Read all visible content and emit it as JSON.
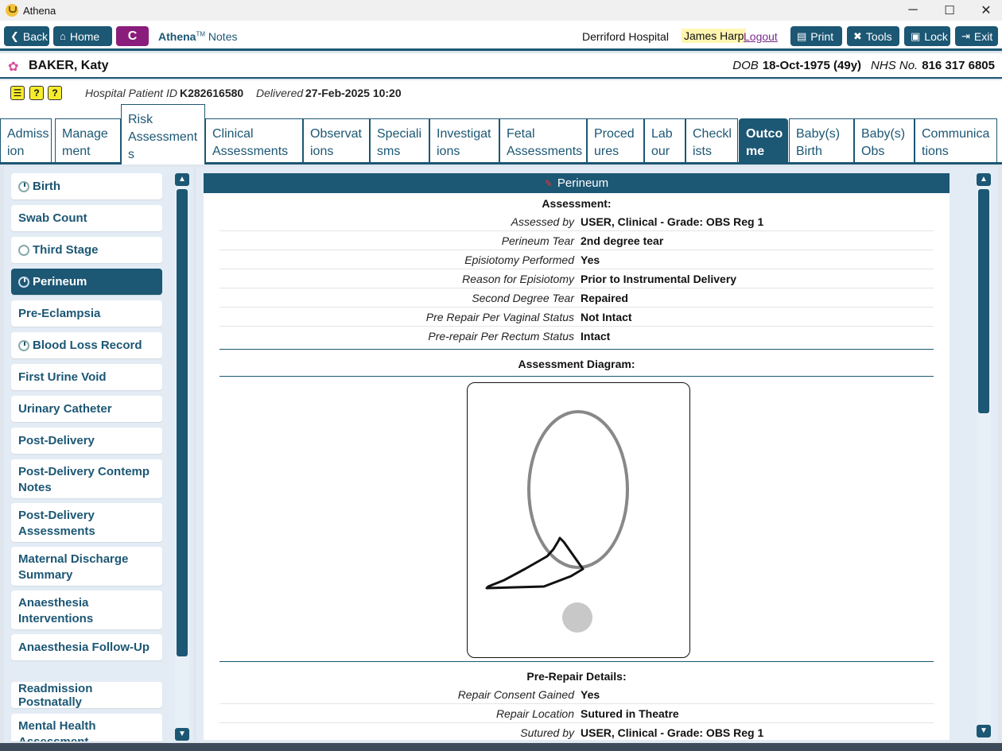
{
  "window": {
    "title": "Athena",
    "minimize": "─",
    "maximize": "☐",
    "close": "✕"
  },
  "toolbar": {
    "back": "Back",
    "home": "Home",
    "c_button": "C",
    "brand_name": "Athena",
    "brand_tm": "TM",
    "brand_suffix": "Notes",
    "hospital": "Derriford Hospital",
    "user": "James Harp",
    "logout": "Logout",
    "print": "Print",
    "tools": "Tools",
    "lock": "Lock",
    "exit": "Exit"
  },
  "patient": {
    "name": "BAKER, Katy",
    "dob_label": "DOB",
    "dob": "18-Oct-1975 (49y)",
    "nhs_label": "NHS No.",
    "nhs": "816 317 6805",
    "hospital_id_label": "Hospital Patient ID",
    "hospital_id": "K282616580",
    "delivered_label": "Delivered",
    "delivered": "27-Feb-2025 10:20"
  },
  "tabs": [
    {
      "l1": "Admiss",
      "l2": "ion"
    },
    {
      "l1": "Manage",
      "l2": "ment"
    },
    {
      "l1": "Risk",
      "l2": "Assessment",
      "l3": "s"
    },
    {
      "l1": "Clinical",
      "l2": "Assessments"
    },
    {
      "l1": "Observat",
      "l2": "ions"
    },
    {
      "l1": "Speciali",
      "l2": "sms"
    },
    {
      "l1": "Investigat",
      "l2": "ions"
    },
    {
      "l1": "Fetal",
      "l2": "Assessments"
    },
    {
      "l1": "Proced",
      "l2": "ures"
    },
    {
      "l1": "Lab",
      "l2": "our"
    },
    {
      "l1": "Checkl",
      "l2": "ists"
    },
    {
      "l1": "Outco",
      "l2": "me"
    },
    {
      "l1": "Baby(s)",
      "l2": "Birth"
    },
    {
      "l1": "Baby(s)",
      "l2": "Obs"
    },
    {
      "l1": "Communica",
      "l2": "tions"
    }
  ],
  "nav": [
    {
      "l1": "Birth",
      "status": "partial"
    },
    {
      "l1": "Swab Count"
    },
    {
      "l1": "Third Stage",
      "status": "empty"
    },
    {
      "l1": "Perineum",
      "status": "partial"
    },
    {
      "l1": "Pre-Eclampsia"
    },
    {
      "l1": "Blood Loss Record",
      "status": "partial"
    },
    {
      "l1": "First Urine Void"
    },
    {
      "l1": "Urinary Catheter"
    },
    {
      "l1": "Post-Delivery"
    },
    {
      "l1": "Post-Delivery Contemp",
      "l2": "Notes"
    },
    {
      "l1": "Post-Delivery",
      "l2": "Assessments"
    },
    {
      "l1": "Maternal Discharge",
      "l2": "Summary"
    },
    {
      "l1": "Anaesthesia",
      "l2": "Interventions"
    },
    {
      "l1": "Anaesthesia Follow-Up"
    },
    {
      "l1": "Readmission Postnatally"
    },
    {
      "l1": "Mental Health",
      "l2": "Assessment"
    }
  ],
  "panel": {
    "title": "Perineum",
    "assessment_heading": "Assessment:",
    "assessment": [
      {
        "k": "Assessed by",
        "v": "USER, Clinical - Grade: OBS Reg 1"
      },
      {
        "k": "Perineum Tear",
        "v": "2nd degree tear"
      },
      {
        "k": "Episiotomy Performed",
        "v": "Yes"
      },
      {
        "k": "Reason for Episiotomy",
        "v": "Prior to Instrumental Delivery"
      },
      {
        "k": "Second Degree Tear",
        "v": "Repaired"
      },
      {
        "k": "Pre Repair Per Vaginal Status",
        "v": "Not Intact"
      },
      {
        "k": "Pre-repair Per Rectum Status",
        "v": "Intact"
      }
    ],
    "diagram_heading": "Assessment Diagram:",
    "prerepair_heading": "Pre-Repair Details:",
    "prerepair": [
      {
        "k": "Repair Consent Gained",
        "v": "Yes"
      },
      {
        "k": "Repair Location",
        "v": "Sutured in Theatre"
      },
      {
        "k": "Sutured by",
        "v": "USER, Clinical - Grade: OBS Reg 1"
      }
    ]
  },
  "colors": {
    "primary": "#1c5774",
    "highlight": "#fff6b0",
    "accent_purple": "#8a1c7c",
    "warning_yellow": "#f7ec2c"
  }
}
